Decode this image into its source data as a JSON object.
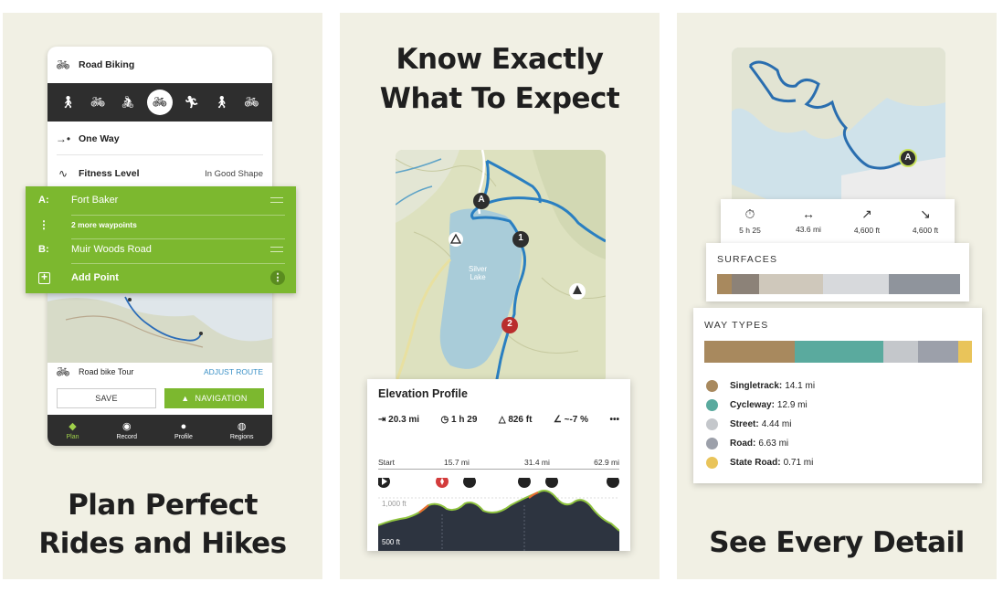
{
  "panel1": {
    "caption_line1": "Plan Perfect",
    "caption_line2": "Rides and Hikes",
    "activity_label": "Road Biking",
    "activity_icons": [
      "hiking-icon",
      "bike-icon",
      "mtb-icon",
      "road-bike-icon",
      "run-icon",
      "walk-icon",
      "gravel-bike-icon"
    ],
    "route_type": "One Way",
    "fitness_label": "Fitness Level",
    "fitness_value": "In Good Shape",
    "waypoint_a_key": "A:",
    "waypoint_a": "Fort Baker",
    "more_waypoints": "2 more waypoints",
    "waypoint_b_key": "B:",
    "waypoint_b": "Muir Woods Road",
    "add_point": "Add Point",
    "route_name": "Road bike Tour",
    "adjust_route": "ADJUST ROUTE",
    "save": "SAVE",
    "navigation": "NAVIGATION",
    "tabs": [
      "Plan",
      "Record",
      "Profile",
      "Regions"
    ]
  },
  "panel2": {
    "caption_line1": "Know Exactly",
    "caption_line2": "What To Expect",
    "lake_label_1": "Silver",
    "lake_label_2": "Lake",
    "marker_a": "A",
    "marker_1": "1",
    "marker_2": "2",
    "profile_title": "Elevation Profile",
    "distance": "20.3 mi",
    "duration": "1 h 29",
    "elevation_gain": "826 ft",
    "grade": "~-7 %",
    "more": "•••",
    "axis_ticks": [
      "Start",
      "15.7 mi",
      "31.4 mi",
      "62.9 mi"
    ],
    "y_top": "1,000 ft",
    "y_bottom": "500 ft"
  },
  "panel3": {
    "caption": "See Every Detail",
    "marker_a": "A",
    "time": "5 h 25",
    "distance": "43.6 mi",
    "ascent": "4,600 ft",
    "descent": "4,600 ft",
    "surfaces_title": "SURFACES",
    "way_types_title": "WAY TYPES",
    "way_types": [
      {
        "name": "Singletrack:",
        "value": "14.1 mi",
        "color": "#a8895e"
      },
      {
        "name": "Cycleway:",
        "value": "12.9 mi",
        "color": "#5aaa9e"
      },
      {
        "name": "Street:",
        "value": "4.44 mi",
        "color": "#c4c7cb"
      },
      {
        "name": "Road:",
        "value": "6.63 mi",
        "color": "#9ca0aa"
      },
      {
        "name": "State Road:",
        "value": "0.71 mi",
        "color": "#e9c45a"
      }
    ]
  }
}
